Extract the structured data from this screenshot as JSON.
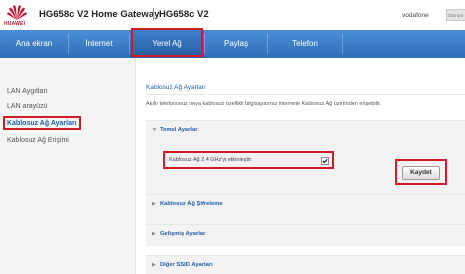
{
  "brand": {
    "logo_text": "HUAWEI"
  },
  "header": {
    "title": "HG658c V2 Home Gateway",
    "subtitle": "HG658c V2",
    "operator": "vodafone",
    "user_box": "Oturum"
  },
  "nav": {
    "tabs": [
      {
        "label": "Ana ekran"
      },
      {
        "label": "İnternet"
      },
      {
        "label": "Yerel Ağ"
      },
      {
        "label": "Paylaş"
      },
      {
        "label": "Telefon"
      }
    ]
  },
  "sidebar": {
    "items": [
      {
        "label": "LAN Aygıtları"
      },
      {
        "label": "LAN arayüzü"
      },
      {
        "label": "Kablosuz Ağ Ayarları"
      },
      {
        "label": "Kablosuz Ağ Erişimi"
      }
    ]
  },
  "content": {
    "page_title": "Kablosuz Ağ Ayarları",
    "description": "Akıllı telefonunuz veya kablosuz özellikli bilgisayarınız internete Kablosuz Ağ üzerinden erişebilir.",
    "sections": [
      {
        "label": "Temel Ayarlar",
        "expanded": true
      },
      {
        "label": "Kablosuz Ağ Şifreleme",
        "expanded": false
      },
      {
        "label": "Gelişmiş Ayarlar",
        "expanded": false
      },
      {
        "label": "Diğer SSID Ayarları",
        "expanded": false
      }
    ],
    "toggle": {
      "label": "Kablosuz Ağ 2.4 GHz'yi etkinleştir:",
      "checked": true
    },
    "save_label": "Kaydet"
  },
  "colors": {
    "accent": "#1d5ea7",
    "nav_bg": "#2f6fb8",
    "highlight": "#d01b28",
    "brand_red": "#c8102e"
  },
  "icons": {
    "logo": "huawei-logo-icon",
    "expanded_caret": "caret-down-icon",
    "collapsed_caret": "caret-right-icon",
    "checkbox": "checkmark-icon"
  }
}
